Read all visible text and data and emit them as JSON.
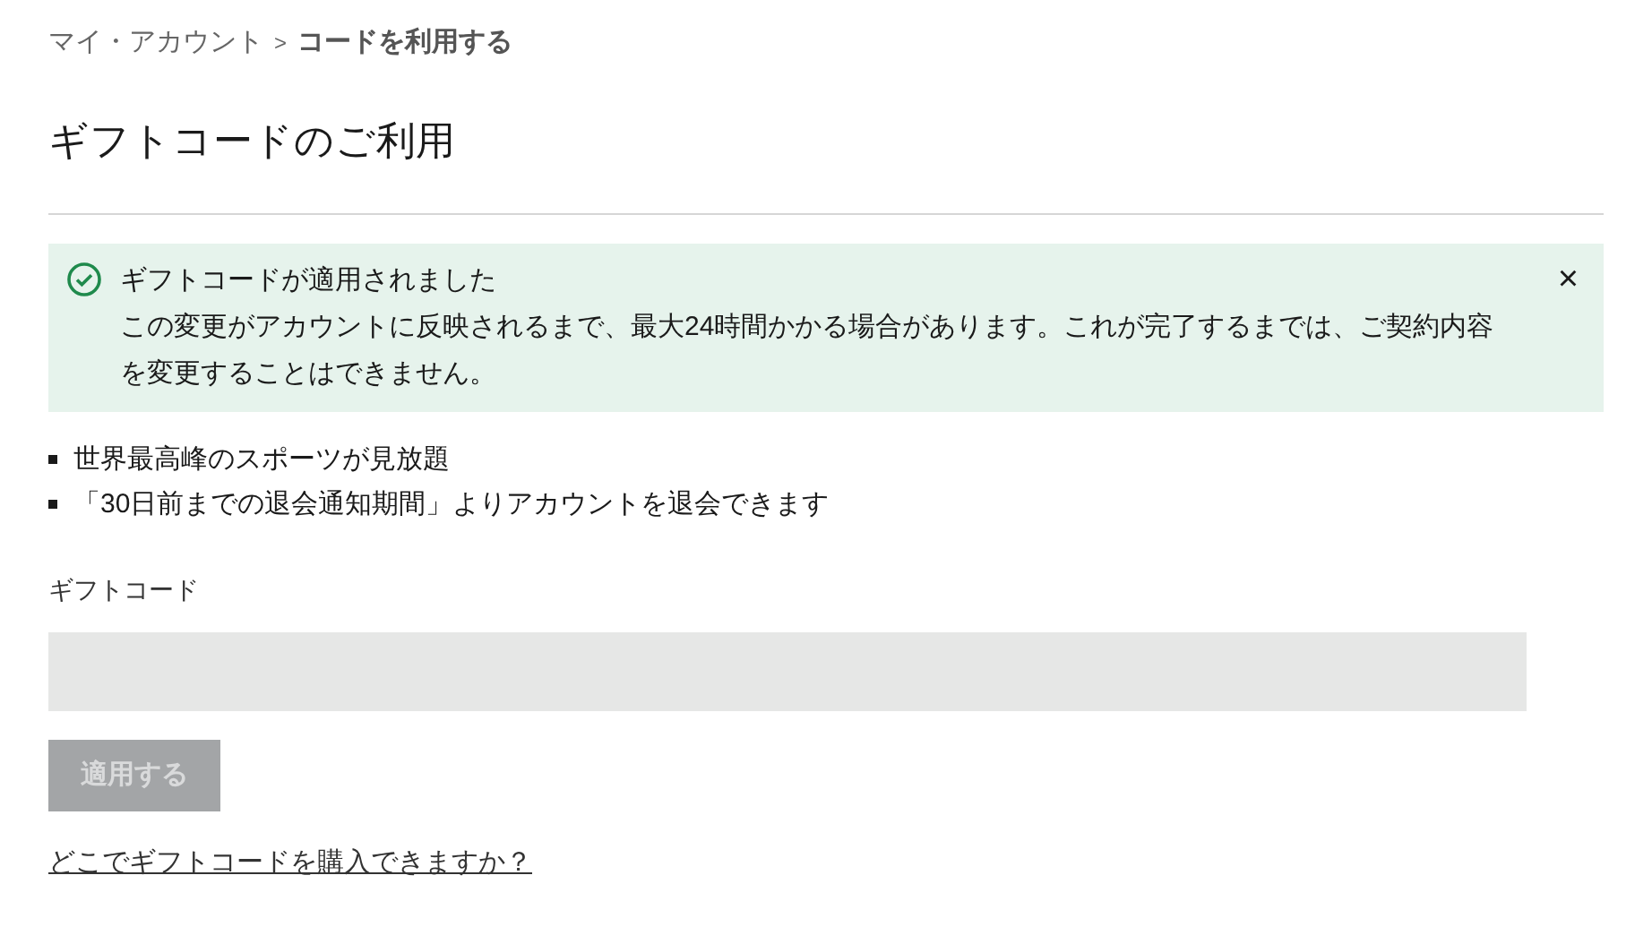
{
  "breadcrumb": [
    {
      "label": "マイ・アカウント",
      "current": false
    },
    {
      "label": "コードを利用する",
      "current": true
    }
  ],
  "breadcrumb_separator": ">",
  "title": "ギフトコードのご利用",
  "alert": {
    "title": "ギフトコードが適用されました",
    "message": "この変更がアカウントに反映されるまで、最大24時間かかる場合があります。これが完了するまでは、ご契約内容を変更することはできません。",
    "close": "×"
  },
  "benefits": [
    "世界最高峰のスポーツが見放題",
    "「30日前までの退会通知期間」よりアカウントを退会できます"
  ],
  "field": {
    "label": "ギフトコード"
  },
  "apply_button": {
    "label": "適用する",
    "disabled": true
  },
  "help_link": "どこでギフトコードを購入できますか？"
}
